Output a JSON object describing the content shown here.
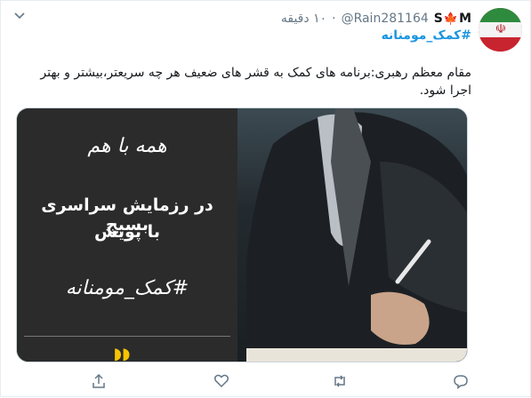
{
  "tweet": {
    "display_name_prefix": "S",
    "display_name_suffix": "M",
    "handle": "@Rain281164",
    "dot": "·",
    "time": "۱۰ دقیقه",
    "hashtag": "#کمک_مومنانه",
    "body": "مقام معظم رهبری:برنامه های کمک به قشر های ضعیف هر چه سریعتر،بیشتر و بهتر اجرا شود."
  },
  "media": {
    "poster_line_1": "همه با هم",
    "poster_line_2": "در رزمایش سراسری بسیج",
    "poster_line_3": "با پویش",
    "poster_line_4": "#کمک_مومنانه"
  },
  "icons": {
    "leaf": "maple-leaf-icon",
    "chevron": "chevron-down-icon",
    "share": "share-icon",
    "like": "heart-icon",
    "retweet": "retweet-icon",
    "reply": "reply-icon"
  },
  "colors": {
    "link": "#1b95e0",
    "muted": "#657786",
    "leaf": "#d52b1e"
  }
}
